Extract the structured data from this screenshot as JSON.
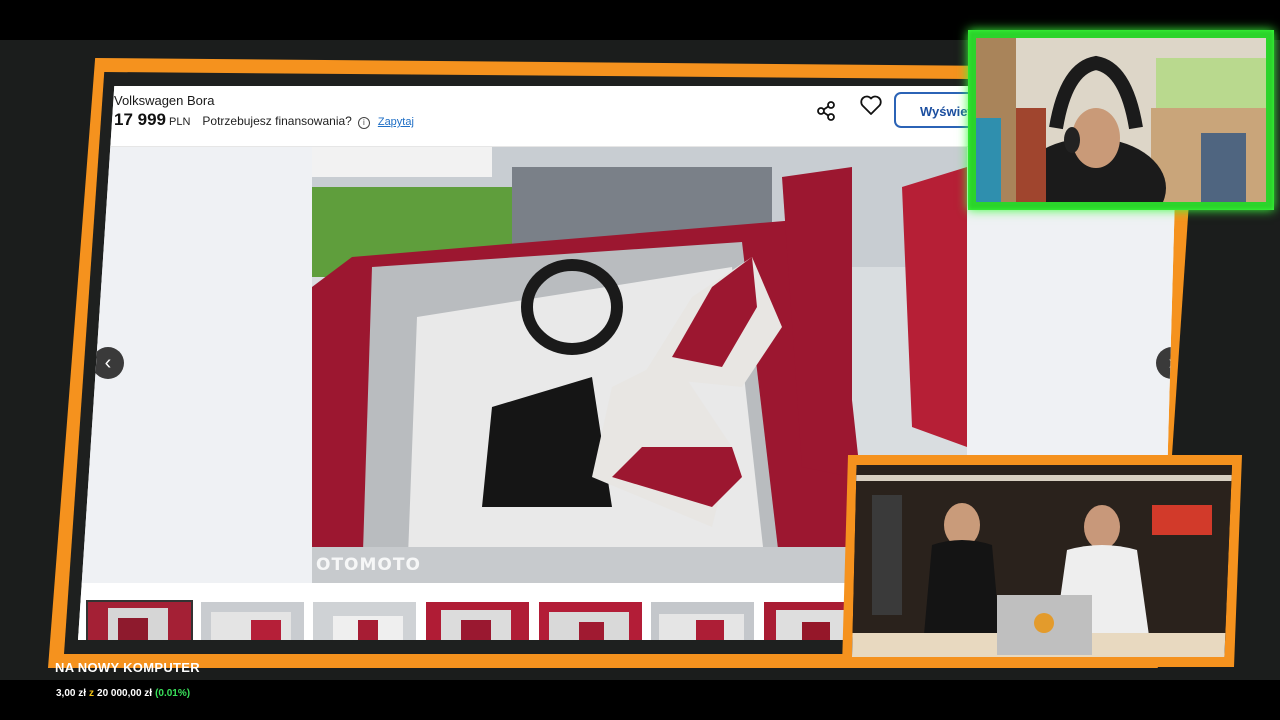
{
  "listing": {
    "title": "Volkswagen Bora",
    "price": "17 999",
    "currency": "PLN",
    "financing_question": "Potrzebujesz finansowania?",
    "ask_link": "Zapytaj",
    "view_button": "Wyświet",
    "watermark": "OTOMOTO"
  },
  "gallery": {
    "prev_arrow": "‹",
    "next_arrow": "›",
    "thumbnail_count": 7,
    "active_thumbnail": 0
  },
  "goal": {
    "title": "NA NOWY KOMPUTER",
    "current": "3,00 zł",
    "of": "z",
    "target": "20 000,00 zł",
    "percent": "(0.01%)"
  },
  "colors": {
    "frame_orange": "#f5921e",
    "webcam_border": "#2bd42b",
    "link_blue": "#1f6fc6",
    "goal_percent_green": "#39e15b",
    "car_red": "#9c1730"
  },
  "icons": {
    "share": "share-icon",
    "favorite": "heart-icon",
    "info": "info-icon"
  }
}
